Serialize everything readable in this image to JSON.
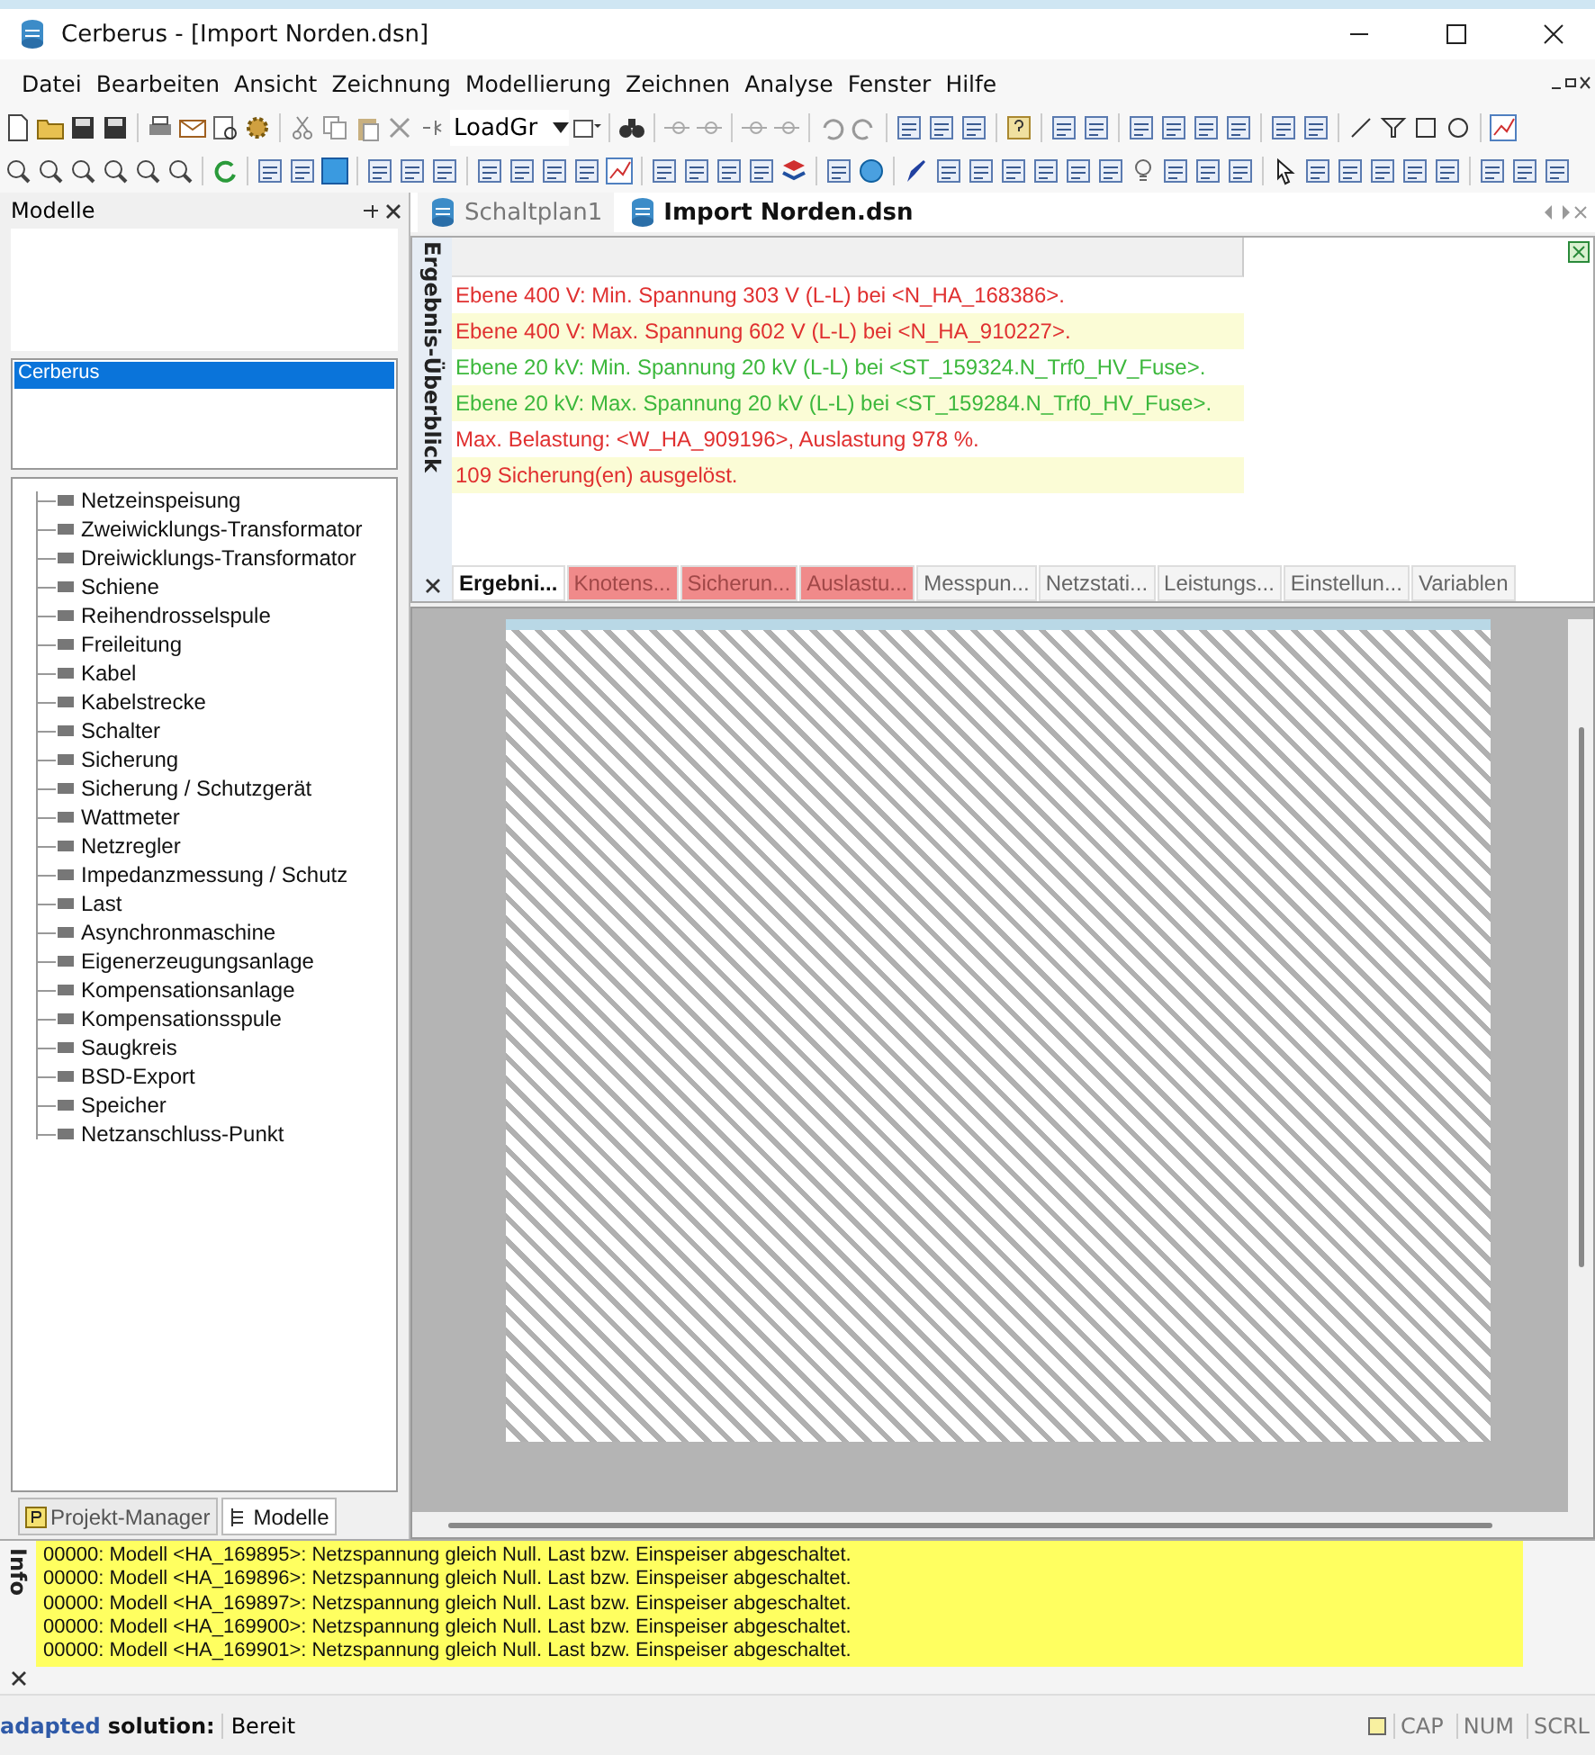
{
  "window": {
    "title": "Cerberus - [Import Norden.dsn]"
  },
  "menu": [
    {
      "label": "Datei"
    },
    {
      "label": "Bearbeiten"
    },
    {
      "label": "Ansicht"
    },
    {
      "label": "Zeichnung"
    },
    {
      "label": "Modellierung"
    },
    {
      "label": "Zeichnen"
    },
    {
      "label": "Analyse"
    },
    {
      "label": "Fenster"
    },
    {
      "label": "Hilfe"
    }
  ],
  "toolbar": {
    "combo_value": "LoadGr"
  },
  "left_panel": {
    "title": "Modelle",
    "list": [
      {
        "label": "Cerberus",
        "selected": true
      }
    ],
    "tree": [
      {
        "label": "Netzeinspeisung"
      },
      {
        "label": "Zweiwicklungs-Transformator"
      },
      {
        "label": "Dreiwicklungs-Transformator"
      },
      {
        "label": "Schiene"
      },
      {
        "label": "Reihendrosselspule"
      },
      {
        "label": "Freileitung"
      },
      {
        "label": "Kabel"
      },
      {
        "label": "Kabelstrecke"
      },
      {
        "label": "Schalter"
      },
      {
        "label": "Sicherung"
      },
      {
        "label": "Sicherung / Schutzgerät"
      },
      {
        "label": "Wattmeter"
      },
      {
        "label": "Netzregler"
      },
      {
        "label": "Impedanzmessung / Schutz"
      },
      {
        "label": "Last"
      },
      {
        "label": "Asynchronmaschine"
      },
      {
        "label": "Eigenerzeugungsanlage"
      },
      {
        "label": "Kompensationsanlage"
      },
      {
        "label": "Kompensationsspule"
      },
      {
        "label": "Saugkreis"
      },
      {
        "label": "BSD-Export"
      },
      {
        "label": "Speicher"
      },
      {
        "label": "Netzanschluss-Punkt"
      }
    ],
    "tabs": [
      {
        "label": "Projekt-Manager",
        "selected": false
      },
      {
        "label": "Modelle",
        "selected": true
      }
    ]
  },
  "document_tabs": [
    {
      "label": "Schaltplan1",
      "selected": false
    },
    {
      "label": "Import Norden.dsn",
      "selected": true
    }
  ],
  "results_panel": {
    "title": "Ergebnis-Überblick",
    "rows": [
      {
        "text": "Ebene 400 V: Min. Spannung 303 V (L-L) bei <N_HA_168386>.",
        "color": "#e03030"
      },
      {
        "text": "Ebene 400 V: Max. Spannung 602 V (L-L) bei <N_HA_910227>.",
        "color": "#e03030"
      },
      {
        "text": "Ebene 20 kV: Min. Spannung 20 kV (L-L) bei <ST_159324.N_Trf0_HV_Fuse>.",
        "color": "#3cb83c"
      },
      {
        "text": "Ebene 20 kV: Max. Spannung 20 kV (L-L) bei <ST_159284.N_Trf0_HV_Fuse>.",
        "color": "#3cb83c"
      },
      {
        "text": "Max. Belastung: <W_HA_909196>, Auslastung 978 %.",
        "color": "#e03030"
      },
      {
        "text": "109 Sicherung(en) ausgelöst.",
        "color": "#e03030"
      }
    ],
    "tabs": [
      {
        "label": "Ergebni...",
        "selected": true,
        "alert": false
      },
      {
        "label": "Knotens...",
        "selected": false,
        "alert": true
      },
      {
        "label": "Sicherun...",
        "selected": false,
        "alert": true
      },
      {
        "label": "Auslastu...",
        "selected": false,
        "alert": true
      },
      {
        "label": "Messpun...",
        "selected": false,
        "alert": false
      },
      {
        "label": "Netzstati...",
        "selected": false,
        "alert": false
      },
      {
        "label": "Leistungs...",
        "selected": false,
        "alert": false
      },
      {
        "label": "Einstellun...",
        "selected": false,
        "alert": false
      },
      {
        "label": "Variablen",
        "selected": false,
        "alert": false
      }
    ]
  },
  "info_panel": {
    "title": "Info",
    "lines": [
      "00000: Modell <HA_169895>: Netzspannung gleich Null. Last  bzw. Einspeiser abgeschaltet.",
      "00000: Modell <HA_169896>: Netzspannung gleich Null. Last  bzw. Einspeiser abgeschaltet.",
      "00000: Modell <HA_169897>: Netzspannung gleich Null. Last  bzw. Einspeiser abgeschaltet.",
      "00000: Modell <HA_169900>: Netzspannung gleich Null. Last  bzw. Einspeiser abgeschaltet.",
      "00000: Modell <HA_169901>: Netzspannung gleich Null. Last  bzw. Einspeiser abgeschaltet."
    ]
  },
  "status_bar": {
    "brand": "adapted",
    "brand_suffix": "solution:",
    "message": "Bereit",
    "indicators": [
      "CAP",
      "NUM",
      "SCRL"
    ]
  }
}
